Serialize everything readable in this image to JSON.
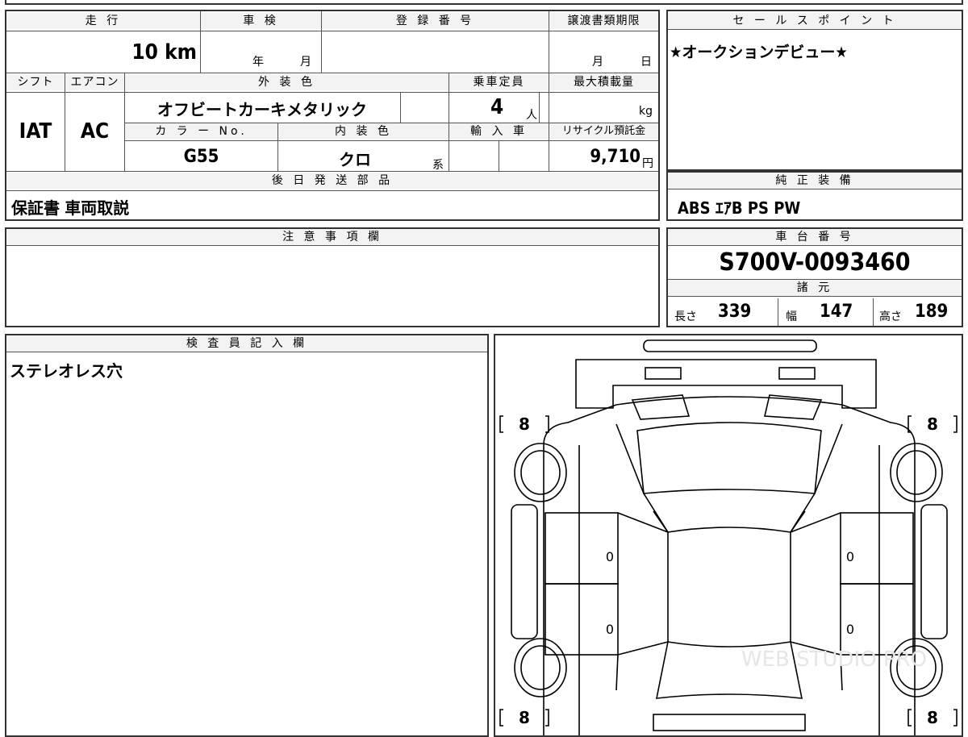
{
  "top_table": {
    "mileage_label": "走 行",
    "mileage_value": "10 km",
    "inspection_label": "車 検",
    "inspection_year": "年",
    "inspection_month": "月",
    "registration_label": "登 録 番 号",
    "deadline_label": "譲渡書類期限",
    "deadline_month": "月",
    "deadline_day": "日",
    "shift_label": "シフト",
    "shift_value": "IAT",
    "ac_label": "エアコン",
    "ac_value": "AC",
    "exterior_color_label": "外 装 色",
    "exterior_color_value": "オフビートカーキメタリック",
    "capacity_label": "乗車定員",
    "capacity_value": "4",
    "capacity_unit": "人",
    "max_load_label": "最大積載量",
    "max_load_unit": "kg",
    "color_no_label": "カ ラ ー No.",
    "color_no_value": "G55",
    "interior_color_label": "内 装 色",
    "interior_color_value": "クロ",
    "interior_color_suffix": "系",
    "import_label": "輸 入 車",
    "recycle_label": "リサイクル預託金",
    "recycle_value": "9,710",
    "recycle_unit": "円",
    "later_parts_label": "後 日 発 送 部 品",
    "later_parts_value": "保証書 車両取説"
  },
  "sales_points": {
    "label": "セ ー ル ス ポ イ ン ト",
    "value": "★オークションデビュー★"
  },
  "genuine_equipment": {
    "label": "純 正 装 備",
    "value": "ABS ｴｱB PS PW"
  },
  "notes": {
    "label": "注 意 事 項 欄",
    "value": ""
  },
  "chassis": {
    "label": "車 台 番 号",
    "value": "S700V-0093460",
    "specs_label": "諸 元",
    "length_label": "長さ",
    "length_value": "339",
    "width_label": "幅",
    "width_value": "147",
    "height_label": "高さ",
    "height_value": "189"
  },
  "inspector": {
    "label": "検 査 員 記 入 欄",
    "value": "ステレオレス穴"
  },
  "diagram": {
    "tire_tl": "8",
    "tire_tr": "8",
    "tire_bl": "8",
    "tire_br": "8",
    "door_fl": "0",
    "door_rl": "0",
    "door_fr": "0",
    "door_rr": "0",
    "watermark": "WEB STUDIO PRO"
  }
}
